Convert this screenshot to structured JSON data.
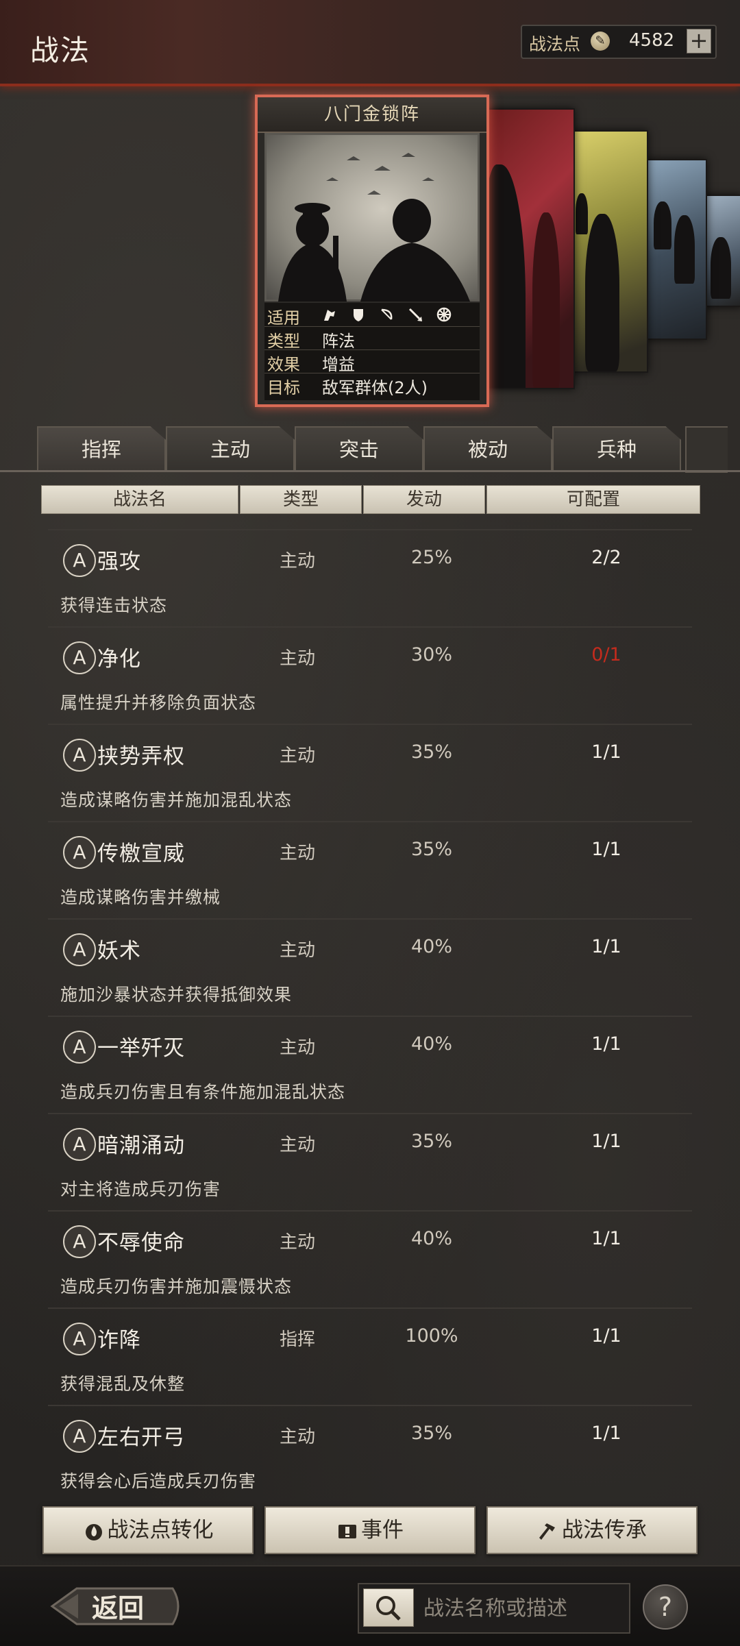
{
  "header": {
    "title": "战法",
    "points_label": "战法点",
    "points_value": "4582",
    "plus_label": "+"
  },
  "featured_card": {
    "name": "八门金锁阵",
    "info": [
      {
        "key": "适用",
        "value": ""
      },
      {
        "key": "类型",
        "value": "阵法"
      },
      {
        "key": "效果",
        "value": "增益"
      },
      {
        "key": "目标",
        "value": "敌军群体(2人)"
      }
    ],
    "unit_icons": [
      "cavalry-icon",
      "shield-icon",
      "bow-icon",
      "spear-icon",
      "wheel-icon"
    ]
  },
  "tabs": [
    "指挥",
    "主动",
    "突击",
    "被动",
    "兵种"
  ],
  "columns": [
    "战法名",
    "类型",
    "发动",
    "可配置"
  ],
  "skills": [
    {
      "grade": "A",
      "name": "强攻",
      "type": "主动",
      "rate": "25%",
      "config": "2/2",
      "desc": "获得连击状态"
    },
    {
      "grade": "A",
      "name": "净化",
      "type": "主动",
      "rate": "30%",
      "config": "0/1",
      "desc": "属性提升并移除负面状态"
    },
    {
      "grade": "A",
      "name": "挟势弄权",
      "type": "主动",
      "rate": "35%",
      "config": "1/1",
      "desc": "造成谋略伤害并施加混乱状态"
    },
    {
      "grade": "A",
      "name": "传檄宣威",
      "type": "主动",
      "rate": "35%",
      "config": "1/1",
      "desc": "造成谋略伤害并缴械"
    },
    {
      "grade": "A",
      "name": "妖术",
      "type": "主动",
      "rate": "40%",
      "config": "1/1",
      "desc": "施加沙暴状态并获得抵御效果"
    },
    {
      "grade": "A",
      "name": "一举歼灭",
      "type": "主动",
      "rate": "40%",
      "config": "1/1",
      "desc": "造成兵刃伤害且有条件施加混乱状态"
    },
    {
      "grade": "A",
      "name": "暗潮涌动",
      "type": "主动",
      "rate": "35%",
      "config": "1/1",
      "desc": "对主将造成兵刃伤害"
    },
    {
      "grade": "A",
      "name": "不辱使命",
      "type": "主动",
      "rate": "40%",
      "config": "1/1",
      "desc": "造成兵刃伤害并施加震慑状态"
    },
    {
      "grade": "A",
      "name": "诈降",
      "type": "指挥",
      "rate": "100%",
      "config": "1/1",
      "desc": "获得混乱及休整"
    },
    {
      "grade": "A",
      "name": "左右开弓",
      "type": "主动",
      "rate": "35%",
      "config": "1/1",
      "desc": "获得会心后造成兵刃伤害"
    }
  ],
  "actions": {
    "convert": "战法点转化",
    "event": "事件",
    "inherit": "战法传承"
  },
  "footer": {
    "back": "返回",
    "search_placeholder": "战法名称或描述",
    "help": "?"
  },
  "colors": {
    "accent_red": "#c42b1d",
    "card_border": "#d86a55"
  }
}
